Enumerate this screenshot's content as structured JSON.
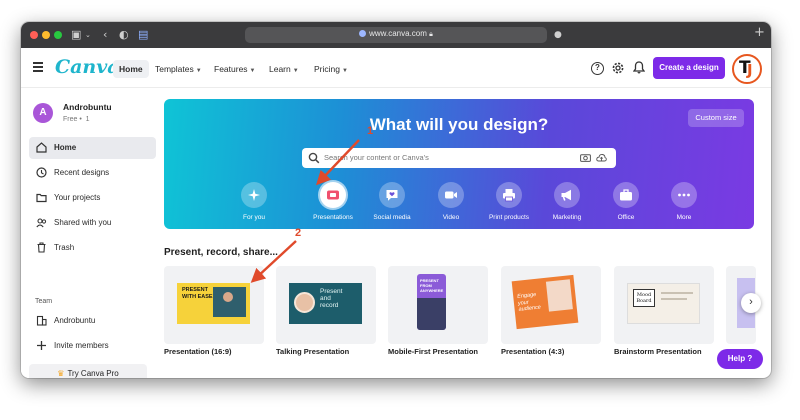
{
  "browser": {
    "url": "www.canva.com"
  },
  "nav": {
    "logo": "Canva",
    "items": [
      {
        "label": "Home",
        "active": true,
        "caret": false
      },
      {
        "label": "Templates",
        "caret": true
      },
      {
        "label": "Features",
        "caret": true
      },
      {
        "label": "Learn",
        "caret": true
      },
      {
        "label": "Pricing",
        "caret": true
      }
    ],
    "create_label": "Create a design",
    "help_icon": "?"
  },
  "user": {
    "initial": "A",
    "name": "Androbuntu",
    "plan": "Free •  1",
    "profile_letters": {
      "t": "T",
      "j": "J"
    }
  },
  "sidebar": {
    "items": [
      {
        "label": "Home",
        "icon": "home-icon"
      },
      {
        "label": "Recent designs",
        "icon": "clock-icon"
      },
      {
        "label": "Your projects",
        "icon": "folder-icon"
      },
      {
        "label": "Shared with you",
        "icon": "people-icon"
      },
      {
        "label": "Trash",
        "icon": "trash-icon"
      }
    ],
    "team_label": "Team",
    "team_items": [
      {
        "label": "Androbuntu",
        "icon": "building-icon"
      },
      {
        "label": "Invite members",
        "icon": "plus-icon"
      }
    ],
    "pro_label": "Try Canva Pro",
    "pro_icon": "♛"
  },
  "hero": {
    "title": "What will you design?",
    "custom_size": "Custom size",
    "search_placeholder": "Search your content or Canva's",
    "categories": [
      {
        "label": "For you",
        "icon": "sparkle-icon"
      },
      {
        "label": "Presentations",
        "icon": "presentation-icon"
      },
      {
        "label": "Social media",
        "icon": "heart-chat-icon"
      },
      {
        "label": "Video",
        "icon": "video-icon"
      },
      {
        "label": "Print products",
        "icon": "printer-icon"
      },
      {
        "label": "Marketing",
        "icon": "megaphone-icon"
      },
      {
        "label": "Office",
        "icon": "briefcase-icon"
      },
      {
        "label": "More",
        "icon": "more-icon"
      }
    ]
  },
  "section": {
    "title": "Present, record, share...",
    "cards": [
      {
        "label": "Presentation (16:9)",
        "thumb_text": "PRESENT\nWITH EASE"
      },
      {
        "label": "Talking Presentation",
        "thumb_text": "Present\nand\nrecord"
      },
      {
        "label": "Mobile-First Presentation",
        "thumb_text": "PRESENT\nFROM\nANYWHERE"
      },
      {
        "label": "Presentation (4:3)",
        "thumb_text": "Engage\nyour\naudience"
      },
      {
        "label": "Brainstorm Presentation",
        "thumb_text": "Mood\nBoard"
      }
    ]
  },
  "help_label": "Help ?",
  "annotations": {
    "one": "1",
    "two": "2",
    "color": "#e04a2b"
  },
  "colors": {
    "brand_purple": "#7d2ae8",
    "logo_teal": "#1fb5cc"
  }
}
